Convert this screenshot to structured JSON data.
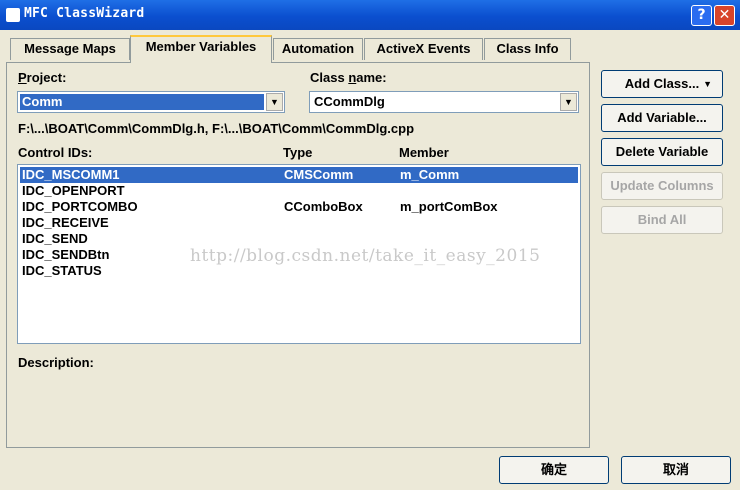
{
  "window": {
    "title": "MFC ClassWizard",
    "help_label": "?",
    "close_label": "✕"
  },
  "tabs": [
    {
      "label": "Message Maps"
    },
    {
      "label": "Member Variables"
    },
    {
      "label": "Automation"
    },
    {
      "label": "ActiveX Events"
    },
    {
      "label": "Class Info"
    }
  ],
  "active_tab": "Member Variables",
  "project": {
    "label_underlined": "P",
    "label_rest": "roject:",
    "value": "Comm"
  },
  "class_name": {
    "label_before": "Class ",
    "label_underlined": "n",
    "label_rest": "ame:",
    "value": "CCommDlg"
  },
  "file_path": "F:\\...\\BOAT\\Comm\\CommDlg.h, F:\\...\\BOAT\\Comm\\CommDlg.cpp",
  "list": {
    "headers": {
      "control_ids": "Control IDs:",
      "control_ids_underlined": "I",
      "type": "Type",
      "member": "Member"
    },
    "rows": [
      {
        "id": "IDC_MSCOMM1",
        "type": "CMSComm",
        "member": "m_Comm",
        "selected": true
      },
      {
        "id": "IDC_OPENPORT",
        "type": "",
        "member": "",
        "selected": false
      },
      {
        "id": "IDC_PORTCOMBO",
        "type": "CComboBox",
        "member": "m_portComBox",
        "selected": false
      },
      {
        "id": "IDC_RECEIVE",
        "type": "",
        "member": "",
        "selected": false
      },
      {
        "id": "IDC_SEND",
        "type": "",
        "member": "",
        "selected": false
      },
      {
        "id": "IDC_SENDBtn",
        "type": "",
        "member": "",
        "selected": false
      },
      {
        "id": "IDC_STATUS",
        "type": "",
        "member": "",
        "selected": false
      }
    ]
  },
  "watermark": "http://blog.csdn.net/take_it_easy_2015",
  "description_label": "Description:",
  "buttons": {
    "add_class": "Add Class...",
    "add_variable": "Add Variable...",
    "delete_variable": "Delete Variable",
    "update_columns": "Update Columns",
    "bind_all": "Bind All",
    "ok": "确定",
    "cancel": "取消"
  },
  "colors": {
    "titlebar": "#0b4fcf",
    "selection": "#316ac5",
    "dialog_bg": "#ece9d8"
  }
}
